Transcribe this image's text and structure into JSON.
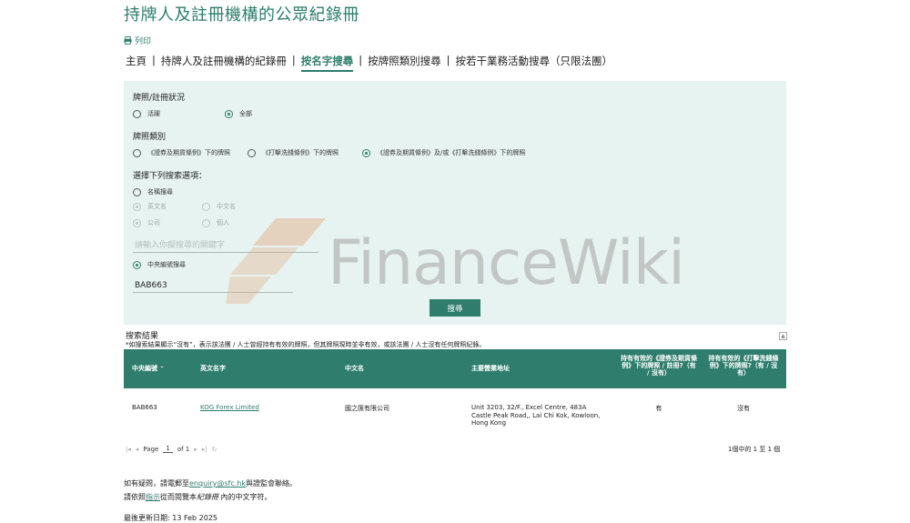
{
  "page_title": "持牌人及註冊機構的公眾紀錄冊",
  "print_label": "列印",
  "nav": {
    "home": "主頁",
    "register": "持牌人及註冊機構的紀錄冊",
    "by_name": "按名字搜尋",
    "by_type": "按牌照類別搜尋",
    "by_activity": "按若干業務活動搜尋（只限法團）",
    "sep": "|"
  },
  "form": {
    "status_label": "牌照/註冊狀況",
    "status_options": [
      "活躍",
      "全部"
    ],
    "status_selected": "全部",
    "license_label": "牌照類別",
    "license_options": [
      "《證券及期貨條例》下的牌照",
      "《打擊洗錢條例》下的牌照",
      "《證券及期貨條例》及/或《打擊洗錢條例》下的牌照"
    ],
    "license_selected": "《證券及期貨條例》及/或《打擊洗錢條例》下的牌照",
    "search_option_label": "選擇下列搜索選項：",
    "name_search": "名稱搜尋",
    "english_name": "英文名",
    "chinese_name": "中文名",
    "company": "公司",
    "individual": "個人",
    "keyword_placeholder": "請輸入你擬搜尋的關鍵字",
    "ce_search": "中央編號搜尋",
    "ce_value": "BAB663",
    "search_button": "搜尋"
  },
  "results": {
    "title": "搜索結果",
    "note": "*如搜索結果顯示“沒有”，表示該法團 / 人士曾經持有有效的牌照，但其牌照現時並非有效，或該法團 / 人士沒有任何牌照紀錄。",
    "columns": [
      "中央編號",
      "英文名字",
      "中文名",
      "主要營業地址",
      "持有有效的《證券及期貨條例》下的牌照 / 註冊?（有 / 沒有）",
      "持有有效的《打擊洗錢條例》下的牌照?（有 / 沒有）"
    ],
    "rows": [
      {
        "ce": "BAB663",
        "en_name": "KOG Forex Limited",
        "zh_name": "國之匯有限公司",
        "address": "Unit 3203, 32/F., Excel Centre, 483A Castle Peak Road,, Lai Chi Kok, Kowloon, Hong Kong",
        "sfo": "有",
        "amlo": "沒有"
      }
    ],
    "pager": {
      "page_label": "Page",
      "page": "1",
      "of": "of 1"
    },
    "count": "1個中的 1 至 1 個"
  },
  "footer": {
    "enquiry_pre": "如有疑問，請電郵至",
    "enquiry_email": "enquiry@sfc.hk",
    "enquiry_post": "與證監會聯絡。",
    "guide_pre": "請依照",
    "guide_link": "指示",
    "guide_mid": "從而閱覽本",
    "guide_em": "紀錄冊",
    "guide_post": " 內的中文字符。",
    "updated": "最後更新日期: 13 Feb 2025"
  },
  "watermark": "FinanceWiki",
  "colors": {
    "brand": "#2e7d6d",
    "panel": "#e7f3f0"
  }
}
